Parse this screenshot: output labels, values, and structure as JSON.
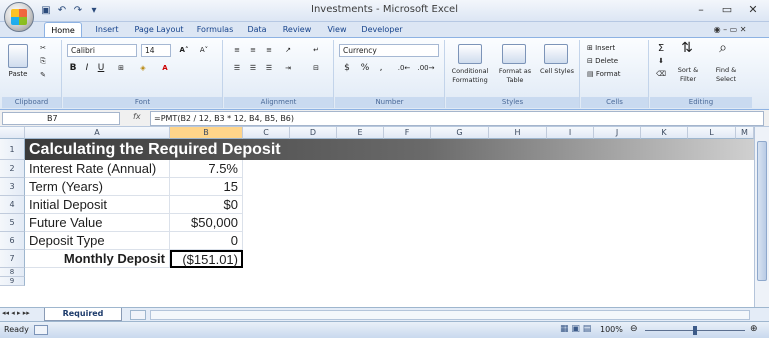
{
  "window": {
    "title": "Investments - Microsoft Excel"
  },
  "tabs": [
    "Home",
    "Insert",
    "Page Layout",
    "Formulas",
    "Data",
    "Review",
    "View",
    "Developer"
  ],
  "ribbon": {
    "clipboard": {
      "label": "Clipboard",
      "paste": "Paste"
    },
    "font": {
      "label": "Font",
      "family": "Calibri",
      "size": "14",
      "bold": "B",
      "italic": "I",
      "underline": "U"
    },
    "alignment": {
      "label": "Alignment"
    },
    "number": {
      "label": "Number",
      "format": "Currency",
      "dollar": "$",
      "percent": "%",
      "comma": ","
    },
    "styles": {
      "label": "Styles",
      "conditional": "Conditional Formatting",
      "format_table": "Format as Table",
      "cell_styles": "Cell Styles"
    },
    "cells": {
      "label": "Cells",
      "insert": "Insert",
      "delete": "Delete",
      "format": "Format"
    },
    "editing": {
      "label": "Editing",
      "sort": "Sort & Filter",
      "find": "Find & Select"
    }
  },
  "formula_bar": {
    "name_box": "B7",
    "fx": "fx",
    "formula": "=PMT(B2 / 12, B3 * 12, B4, B5, B6)"
  },
  "columns": [
    "A",
    "B",
    "C",
    "D",
    "E",
    "F",
    "G",
    "H",
    "I",
    "J",
    "K",
    "L",
    "M"
  ],
  "rows": [
    {
      "num": "1",
      "a": "Calculating the Required Deposit",
      "b": ""
    },
    {
      "num": "2",
      "a": "Interest Rate (Annual)",
      "b": "7.5%"
    },
    {
      "num": "3",
      "a": "Term (Years)",
      "b": "15"
    },
    {
      "num": "4",
      "a": "Initial Deposit",
      "b": "$0"
    },
    {
      "num": "5",
      "a": "Future Value",
      "b": "$50,000"
    },
    {
      "num": "6",
      "a": "Deposit Type",
      "b": "0"
    },
    {
      "num": "7",
      "a": "Monthly Deposit",
      "b": "($151.01)"
    },
    {
      "num": "8",
      "a": "",
      "b": ""
    },
    {
      "num": "9",
      "a": "",
      "b": ""
    }
  ],
  "sheet_tab": "Required Deposit",
  "status": {
    "ready": "Ready",
    "zoom": "100%"
  },
  "colors": {
    "title_band": "#555555",
    "accent": "#15428b"
  }
}
